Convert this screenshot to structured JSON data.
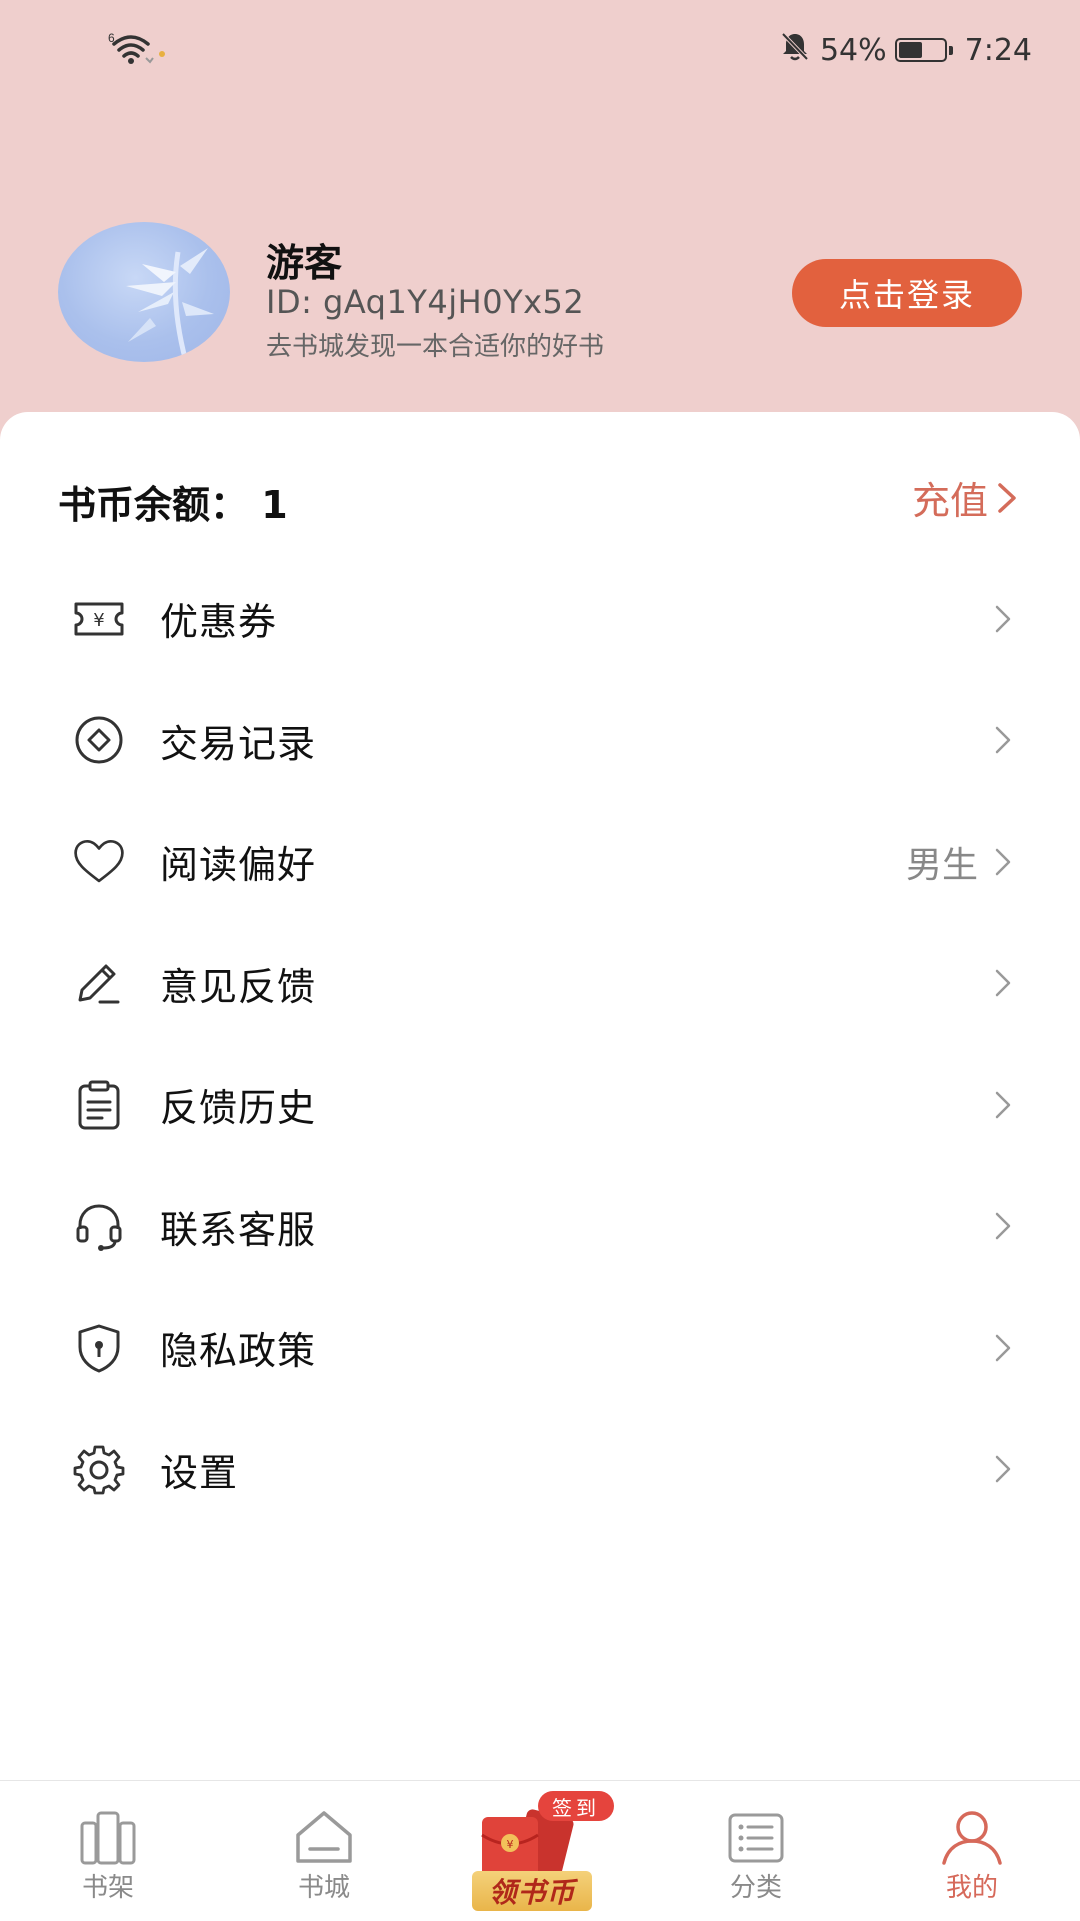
{
  "status_bar": {
    "signal_label": "6",
    "battery_percent": "54%",
    "battery_level": 0.54,
    "time": "7:24",
    "icons": [
      "wifi-icon",
      "notifications-muted-icon",
      "battery-icon"
    ]
  },
  "profile": {
    "name": "游客",
    "id_text": "ID: gAq1Y4jH0Yx52",
    "tagline": "去书城发现一本合适你的好书",
    "login_button": "点击登录"
  },
  "balance": {
    "label": "书币余额：",
    "value": "1",
    "recharge_label": "充值"
  },
  "menu": {
    "items": [
      {
        "label": "优惠券",
        "icon": "coupon-icon",
        "value": ""
      },
      {
        "label": "交易记录",
        "icon": "transaction-icon",
        "value": ""
      },
      {
        "label": "阅读偏好",
        "icon": "heart-icon",
        "value": "男生"
      },
      {
        "label": "意见反馈",
        "icon": "edit-icon",
        "value": ""
      },
      {
        "label": "反馈历史",
        "icon": "clipboard-icon",
        "value": ""
      },
      {
        "label": "联系客服",
        "icon": "headset-icon",
        "value": ""
      },
      {
        "label": "隐私政策",
        "icon": "shield-icon",
        "value": ""
      },
      {
        "label": "设置",
        "icon": "gear-icon",
        "value": ""
      }
    ]
  },
  "bottom_nav": {
    "tabs": [
      {
        "label": "书架",
        "icon": "bookshelf-icon"
      },
      {
        "label": "书城",
        "icon": "bookstore-icon"
      },
      {
        "label": "分类",
        "icon": "category-list-icon"
      },
      {
        "label": "我的",
        "icon": "profile-icon"
      }
    ],
    "active_tab": "我的",
    "promo": {
      "badge": "签到",
      "label": "领书币",
      "icon": "red-envelope-icon"
    }
  },
  "colors": {
    "header_bg": "#efcfcd",
    "accent": "#e2613e",
    "recharge_text": "#d46c5a",
    "active_tab": "#d6695a"
  }
}
